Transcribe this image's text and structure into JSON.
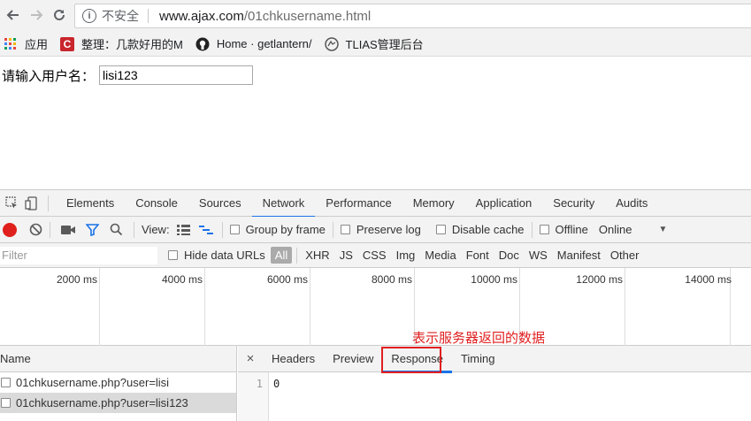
{
  "browser": {
    "insecure_label": "不安全",
    "url_host": "www.ajax.com",
    "url_path": "/01chkusername.html",
    "bookmarks": [
      {
        "label": "应用"
      },
      {
        "label": "整理：几款好用的M"
      },
      {
        "label": "Home · getlantern/"
      },
      {
        "label": "TLIAS管理后台"
      }
    ]
  },
  "page": {
    "label": "请输入用户名：",
    "input_value": "lisi123"
  },
  "devtools": {
    "tabs": [
      "Elements",
      "Console",
      "Sources",
      "Network",
      "Performance",
      "Memory",
      "Application",
      "Security",
      "Audits"
    ],
    "active_tab": "Network",
    "toolbar": {
      "view_label": "View:",
      "group_by_frame": "Group by frame",
      "preserve_log": "Preserve log",
      "disable_cache": "Disable cache",
      "offline": "Offline",
      "online": "Online"
    },
    "filter": {
      "placeholder": "Filter",
      "hide_data_urls": "Hide data URLs",
      "types": [
        "All",
        "XHR",
        "JS",
        "CSS",
        "Img",
        "Media",
        "Font",
        "Doc",
        "WS",
        "Manifest",
        "Other"
      ]
    },
    "timeline_labels": [
      "2000 ms",
      "4000 ms",
      "6000 ms",
      "8000 ms",
      "10000 ms",
      "12000 ms",
      "14000 ms"
    ],
    "name_header": "Name",
    "requests": [
      {
        "name": "01chkusername.php?user=lisi"
      },
      {
        "name": "01chkusername.php?user=lisi123"
      }
    ],
    "detail_tabs": [
      "Headers",
      "Preview",
      "Response",
      "Timing"
    ],
    "active_detail_tab": "Response",
    "response": {
      "line_number": "1",
      "content": "0"
    },
    "annotation": "表示服务器返回的数据"
  }
}
